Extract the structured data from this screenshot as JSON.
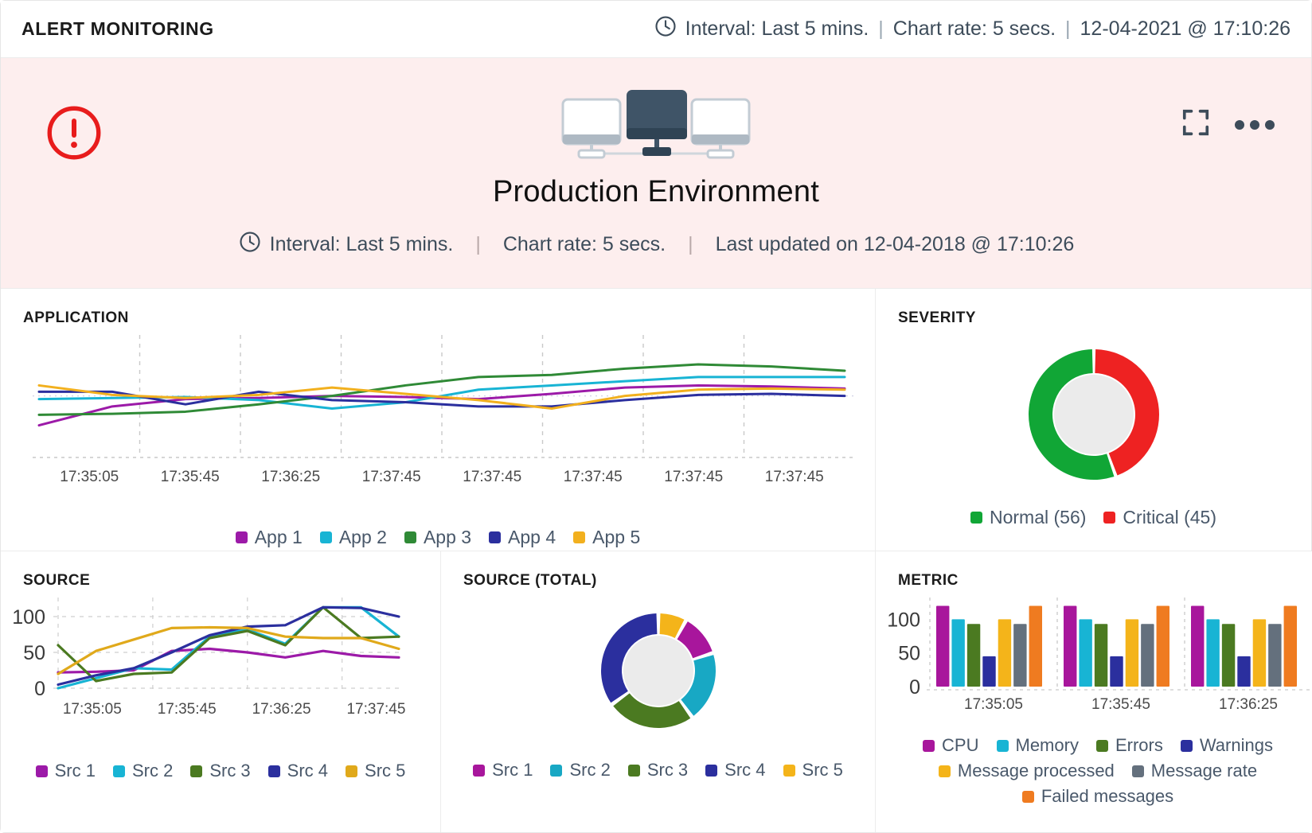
{
  "topbar": {
    "title": "ALERT MONITORING",
    "clock_icon": "clock-icon",
    "interval": "Interval: Last 5 mins.",
    "sep1": "|",
    "chart_rate": "Chart rate: 5 secs.",
    "sep2": "|",
    "timestamp": "12-04-2021 @ 17:10:26"
  },
  "banner": {
    "alert_icon": "alert-circle-icon",
    "graphic_icon": "monitor-network-icon",
    "fullscreen_icon": "fullscreen-icon",
    "more_icon": "more-options-icon",
    "title": "Production Environment",
    "clock_icon": "clock-icon",
    "interval": "Interval: Last 5 mins.",
    "sep1": "|",
    "chart_rate": "Chart rate: 5 secs.",
    "sep2": "|",
    "last_updated": "Last updated on 12-04-2018 @ 17:10:26",
    "bg_color": "#fdeeee",
    "alert_color": "#e81c1c"
  },
  "panels": {
    "application": {
      "title": "APPLICATION"
    },
    "severity": {
      "title": "SEVERITY"
    },
    "source": {
      "title": "SOURCE"
    },
    "source_total": {
      "title": "SOURCE (TOTAL)"
    },
    "metric": {
      "title": "METRIC"
    }
  },
  "chart_data": [
    {
      "id": "application",
      "type": "line",
      "title": "APPLICATION",
      "xlabel": "",
      "ylabel": "",
      "grid": true,
      "legend_position": "bottom",
      "x": [
        "17:35:05",
        "17:35:45",
        "17:36:25",
        "17:37:45",
        "17:37:45",
        "17:37:45",
        "17:37:45",
        "17:37:45"
      ],
      "tick_labels": [
        "17:35:05",
        "17:35:45",
        "17:36:25",
        "17:37:45",
        "17:37:45",
        "17:37:45",
        "17:37:45",
        "17:37:45"
      ],
      "ylim": [
        0,
        100
      ],
      "series": [
        {
          "name": "App 1",
          "color": "#9c1aa8",
          "values": [
            20,
            38,
            45,
            46,
            48,
            47,
            45,
            50,
            56,
            58,
            57,
            55
          ]
        },
        {
          "name": "App 2",
          "color": "#18b4d4",
          "values": [
            45,
            46,
            47,
            44,
            36,
            42,
            54,
            58,
            62,
            66,
            66,
            66
          ]
        },
        {
          "name": "App 3",
          "color": "#2f8a36",
          "values": [
            30,
            31,
            33,
            40,
            48,
            58,
            66,
            68,
            74,
            78,
            76,
            72
          ]
        },
        {
          "name": "App 4",
          "color": "#2b2f9e",
          "values": [
            52,
            52,
            40,
            52,
            44,
            42,
            38,
            38,
            44,
            49,
            50,
            48
          ]
        },
        {
          "name": "App 5",
          "color": "#f2b01e",
          "values": [
            58,
            49,
            46,
            49,
            56,
            50,
            44,
            36,
            48,
            54,
            55,
            54
          ]
        }
      ]
    },
    {
      "id": "severity",
      "type": "pie",
      "title": "SEVERITY",
      "donut": true,
      "legend_position": "bottom",
      "labels": [
        "Normal (56)",
        "Critical (45)"
      ],
      "slice_names": [
        "Normal",
        "Critical"
      ],
      "values": [
        56,
        45
      ],
      "colors": [
        "#11a636",
        "#ee2222"
      ]
    },
    {
      "id": "source",
      "type": "line",
      "title": "SOURCE",
      "grid": true,
      "legend_position": "bottom",
      "ylim": [
        0,
        120
      ],
      "yticks": [
        0,
        50,
        100
      ],
      "tick_labels": [
        "17:35:05",
        "17:35:45",
        "17:36:25",
        "17:37:45"
      ],
      "series": [
        {
          "name": "Src 1",
          "color": "#9c1aa8",
          "values": [
            22,
            23,
            25,
            52,
            55,
            50,
            43,
            52,
            45,
            43
          ]
        },
        {
          "name": "Src 2",
          "color": "#18b4d4",
          "values": [
            0,
            14,
            28,
            26,
            72,
            82,
            62,
            113,
            113,
            72
          ]
        },
        {
          "name": "Src 3",
          "color": "#4b7a21",
          "values": [
            60,
            10,
            20,
            22,
            70,
            80,
            60,
            113,
            70,
            72
          ]
        },
        {
          "name": "Src 4",
          "color": "#2b2f9e",
          "values": [
            5,
            18,
            28,
            50,
            74,
            86,
            88,
            113,
            112,
            100
          ]
        },
        {
          "name": "Src 5",
          "color": "#e0a91b",
          "values": [
            20,
            52,
            68,
            84,
            85,
            84,
            72,
            70,
            70,
            55
          ]
        }
      ]
    },
    {
      "id": "source_total",
      "type": "pie",
      "title": "SOURCE (TOTAL)",
      "donut": true,
      "legend_position": "bottom",
      "labels": [
        "Src 1",
        "Src 2",
        "Src 3",
        "Src 4",
        "Src 5"
      ],
      "values": [
        12,
        20,
        25,
        35,
        8
      ],
      "colors": [
        "#a8169c",
        "#18a8c4",
        "#4b7a21",
        "#2b2f9e",
        "#f4b41a"
      ]
    },
    {
      "id": "metric",
      "type": "bar",
      "title": "METRIC",
      "grid": true,
      "legend_position": "bottom",
      "ylim": [
        0,
        130
      ],
      "yticks": [
        0,
        50,
        100
      ],
      "categories": [
        "17:35:05",
        "17:35:45",
        "17:36:25"
      ],
      "series": [
        {
          "name": "CPU",
          "color": "#a8169c",
          "values": [
            120,
            120,
            120
          ]
        },
        {
          "name": "Memory",
          "color": "#18b4d4",
          "values": [
            100,
            100,
            100
          ]
        },
        {
          "name": "Errors",
          "color": "#4b7a21",
          "values": [
            93,
            93,
            93
          ]
        },
        {
          "name": "Warnings",
          "color": "#2b2f9e",
          "values": [
            45,
            45,
            45
          ]
        },
        {
          "name": "Message processed",
          "color": "#f4b41a",
          "values": [
            100,
            100,
            100
          ]
        },
        {
          "name": "Message rate",
          "color": "#64707d",
          "values": [
            93,
            93,
            93
          ]
        },
        {
          "name": "Failed messages",
          "color": "#ef7b20",
          "values": [
            120,
            120,
            120
          ]
        }
      ]
    }
  ]
}
